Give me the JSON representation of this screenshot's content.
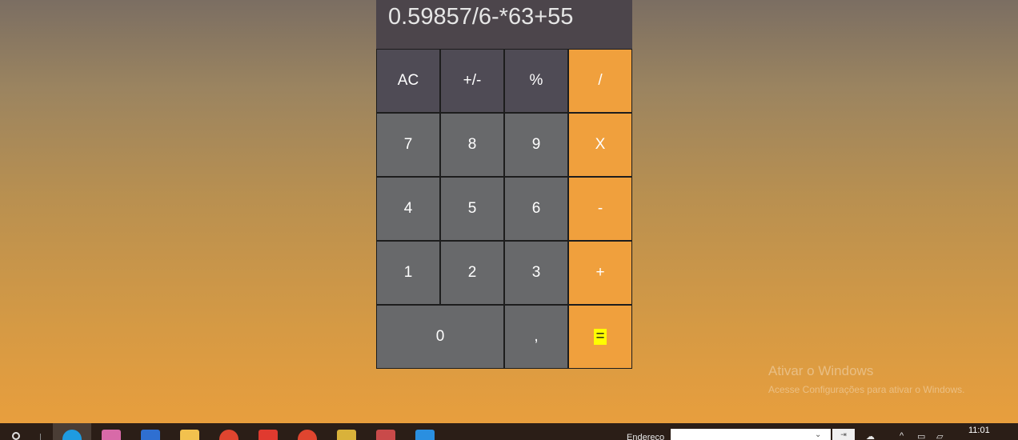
{
  "display": {
    "expression": "0.59857/6-*63+55"
  },
  "keys": [
    {
      "label": "AC",
      "name": "clear-button",
      "kind": "fn"
    },
    {
      "label": "+/-",
      "name": "toggle-sign-button",
      "kind": "fn"
    },
    {
      "label": "%",
      "name": "percent-button",
      "kind": "fn"
    },
    {
      "label": "/",
      "name": "divide-button",
      "kind": "op"
    },
    {
      "label": "7",
      "name": "digit-7-button",
      "kind": "num"
    },
    {
      "label": "8",
      "name": "digit-8-button",
      "kind": "num"
    },
    {
      "label": "9",
      "name": "digit-9-button",
      "kind": "num"
    },
    {
      "label": "X",
      "name": "multiply-button",
      "kind": "op"
    },
    {
      "label": "4",
      "name": "digit-4-button",
      "kind": "num"
    },
    {
      "label": "5",
      "name": "digit-5-button",
      "kind": "num"
    },
    {
      "label": "6",
      "name": "digit-6-button",
      "kind": "num"
    },
    {
      "label": "-",
      "name": "subtract-button",
      "kind": "op"
    },
    {
      "label": "1",
      "name": "digit-1-button",
      "kind": "num"
    },
    {
      "label": "2",
      "name": "digit-2-button",
      "kind": "num"
    },
    {
      "label": "3",
      "name": "digit-3-button",
      "kind": "num"
    },
    {
      "label": "+",
      "name": "add-button",
      "kind": "op"
    },
    {
      "label": "0",
      "name": "digit-0-button",
      "kind": "num",
      "wide": true
    },
    {
      "label": ",",
      "name": "decimal-button",
      "kind": "num"
    },
    {
      "label": "=",
      "name": "equals-button",
      "kind": "op",
      "highlight": true
    }
  ],
  "colors": {
    "function_key": "#4f4b55",
    "number_key": "#68696b",
    "operator_key": "#f0a03d",
    "display_bg": "#4c454b",
    "equals_highlight": "#ffff00"
  },
  "watermark": {
    "line1": "Ativar o Windows",
    "line2": "Acesse Configurações para ativar o Windows."
  },
  "taskbar": {
    "apps": [
      {
        "name": "edge-icon",
        "color": "#1e9be0"
      },
      {
        "name": "paint-icon",
        "color": "#d86aa8"
      },
      {
        "name": "mail-icon",
        "color": "#2f6fd1"
      },
      {
        "name": "folder-icon",
        "color": "#f2c14e"
      },
      {
        "name": "chrome-icon",
        "color": "#e0452f"
      },
      {
        "name": "game-icon",
        "color": "#e03a2f"
      },
      {
        "name": "chrome-icon",
        "color": "#e0452f"
      },
      {
        "name": "app-icon",
        "color": "#d9b23a"
      },
      {
        "name": "tool-icon",
        "color": "#c94a4a"
      },
      {
        "name": "vscode-icon",
        "color": "#2a8fe0"
      }
    ],
    "address_label": "Endereço",
    "time": "11:01"
  }
}
